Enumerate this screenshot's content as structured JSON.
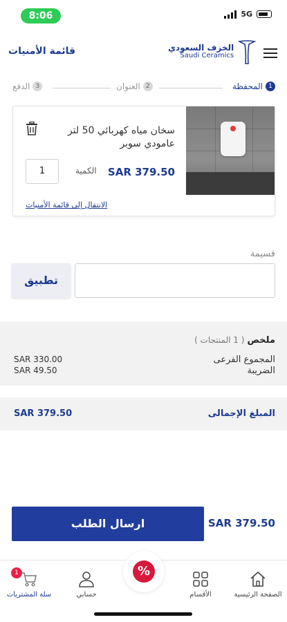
{
  "status_bar": {
    "time": "8:06",
    "network": "5G"
  },
  "header": {
    "wishlist_link": "قائمة الأمنيات",
    "logo_ar": "الخزف السعودي",
    "logo_en": "Saudi Ceramics"
  },
  "stepper": [
    {
      "num": "1",
      "label": "المحفظة"
    },
    {
      "num": "2",
      "label": "العنوان"
    },
    {
      "num": "3",
      "label": "الدفع"
    }
  ],
  "cart_item": {
    "name": "سخان مياه كهربائي 50 لتر عامودي سوبر",
    "price": "SAR 379.50",
    "qty_label": "الكمية",
    "qty": "1",
    "move_link": "الانتقال إلى قائمة الأمنيات"
  },
  "coupon": {
    "label": "قسيمة",
    "apply": "تطبيق"
  },
  "summary": {
    "title": "ملخص",
    "count": "( 1 المنتجات )",
    "subtotal_label": "المجموع الفرعى",
    "subtotal": "SAR 330.00",
    "tax_label": "الضريبة",
    "tax": "SAR 49.50",
    "total_label": "المبلغ الإجمالى",
    "total": "SAR 379.50"
  },
  "checkout": {
    "total": "SAR 379.50",
    "submit": "ارسال الطلب"
  },
  "tabbar": {
    "home": "الصفحة الرئيسية",
    "categories": "الأقسام",
    "account": "حسابي",
    "cart": "سلة المشتريات",
    "cart_badge": "1",
    "promo": "%"
  },
  "colors": {
    "brand": "#1d3b8f",
    "button": "#213d9e",
    "badge": "#e8204a",
    "promo": "#d7193c"
  }
}
